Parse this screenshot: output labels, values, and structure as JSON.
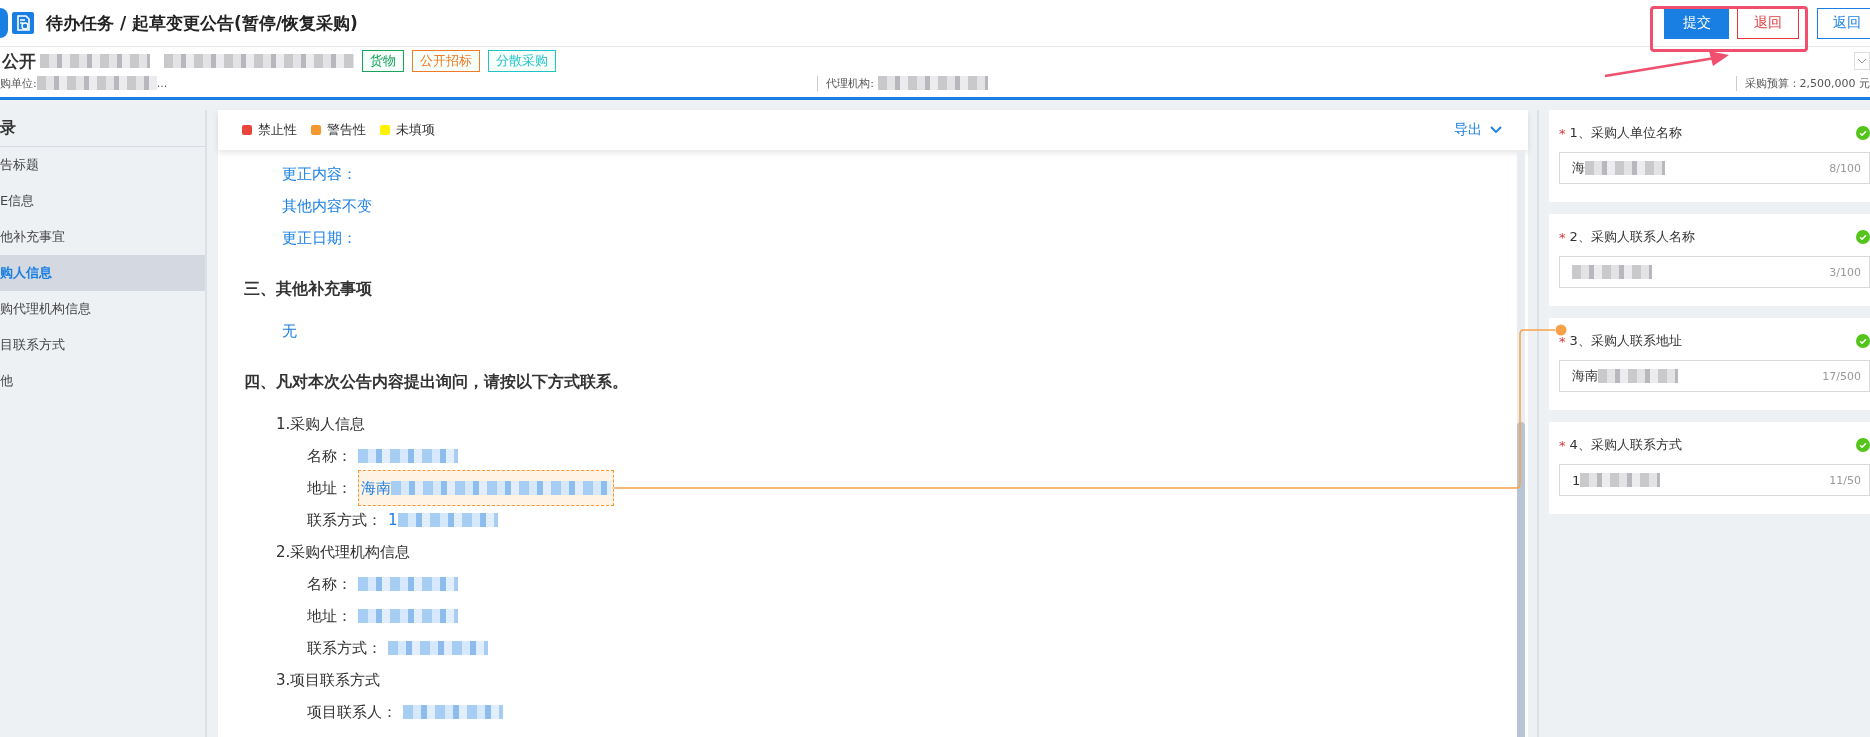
{
  "header": {
    "breadcrumb": "待办任务 / 起草变更公告(暂停/恢复采购)",
    "buttons": [
      {
        "label": "提交",
        "kind": "primary"
      },
      {
        "label": "退回",
        "kind": "danger"
      },
      {
        "label": "返回",
        "kind": "default"
      }
    ]
  },
  "project": {
    "title_prefix": "公开",
    "tags": [
      {
        "label": "货物",
        "color": "#1aa15d"
      },
      {
        "label": "公开招标",
        "color": "#f07a25"
      },
      {
        "label": "分散采购",
        "color": "#22c3c8"
      }
    ],
    "purchaser_label": "购单位:",
    "purchaser_tail": "...",
    "agency_label": "代理机构:",
    "budget": "采购预算：2,500,000 元"
  },
  "outline": {
    "title": "录",
    "items": [
      {
        "label": "告标题",
        "selected": false
      },
      {
        "label": "E信息",
        "selected": false
      },
      {
        "label": "他补充事宜",
        "selected": false
      },
      {
        "label": "购人信息",
        "selected": true
      },
      {
        "label": "购代理机构信息",
        "selected": false
      },
      {
        "label": "目联系方式",
        "selected": false
      },
      {
        "label": "他",
        "selected": false
      }
    ]
  },
  "legend": [
    {
      "label": "禁止性",
      "color": "#e8453c"
    },
    {
      "label": "警告性",
      "color": "#f7972f"
    },
    {
      "label": "未填项",
      "color": "#fff200"
    }
  ],
  "export": "导出",
  "document": [
    {
      "kind": "value",
      "text": "更正内容："
    },
    {
      "kind": "value",
      "text": "其他内容不变"
    },
    {
      "kind": "value",
      "text": "更正日期："
    },
    {
      "kind": "heading",
      "text": "三、其他补充事项"
    },
    {
      "kind": "value",
      "text": "无"
    },
    {
      "kind": "heading",
      "text": "四、凡对本次公告内容提出询问，请按以下方式联系。"
    },
    {
      "kind": "subheading",
      "text": "1.采购人信息"
    },
    {
      "kind": "field",
      "label": "名称：",
      "redacted": true,
      "highlighted": false
    },
    {
      "kind": "field",
      "label": "地址：",
      "value": "海南",
      "redacted": true,
      "highlighted": true
    },
    {
      "kind": "field",
      "label": "联系方式：",
      "value": "1",
      "redacted": true,
      "highlighted": false
    },
    {
      "kind": "subheading",
      "text": "2.采购代理机构信息"
    },
    {
      "kind": "field",
      "label": "名称：",
      "redacted": true,
      "highlighted": false
    },
    {
      "kind": "field",
      "label": "地址：",
      "redacted": true,
      "highlighted": false
    },
    {
      "kind": "field",
      "label": "联系方式：",
      "redacted": true,
      "highlighted": false
    },
    {
      "kind": "subheading",
      "text": "3.项目联系方式"
    },
    {
      "kind": "field",
      "label": "项目联系人：",
      "redacted": true,
      "highlighted": false
    }
  ],
  "fields": [
    {
      "required_mark": "*",
      "label": "1、采购人单位名称",
      "value": "海",
      "count": "8/100",
      "valid": true,
      "linked": false
    },
    {
      "required_mark": "*",
      "label": "2、采购人联系人名称",
      "count": "3/100",
      "valid": true,
      "linked": false
    },
    {
      "required_mark": "*",
      "label": "3、采购人联系地址",
      "value": "海南",
      "count": "17/500",
      "valid": true,
      "linked": true
    },
    {
      "required_mark": "*",
      "label": "4、采购人联系方式",
      "value": "1",
      "count": "11/50",
      "valid": true,
      "linked": false
    }
  ]
}
